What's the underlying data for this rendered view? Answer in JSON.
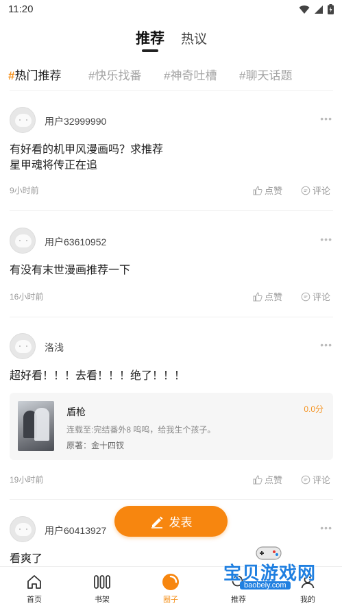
{
  "status_bar": {
    "time": "11:20"
  },
  "top_tabs": [
    {
      "label": "推荐",
      "active": true
    },
    {
      "label": "热议",
      "active": false
    }
  ],
  "topics": [
    {
      "hash": "#",
      "label": "热门推荐",
      "active": true
    },
    {
      "hash": "#",
      "label": "快乐找番",
      "active": false
    },
    {
      "hash": "#",
      "label": "神奇吐槽",
      "active": false
    },
    {
      "hash": "#",
      "label": "聊天话题",
      "active": false
    }
  ],
  "posts": [
    {
      "username": "用户32999990",
      "content": "有好看的机甲风漫画吗？求推荐\n星甲魂将传正在追",
      "time": "9小时前"
    },
    {
      "username": "用户63610952",
      "content": "有没有末世漫画推荐一下",
      "time": "16小时前"
    },
    {
      "username": "洛浅",
      "content": "超好看！！！去看！！！绝了！！！",
      "time": "19小时前"
    },
    {
      "username": "用户60413927",
      "content": "看爽了",
      "time": ""
    }
  ],
  "actions": {
    "like": "点赞",
    "comment": "评论"
  },
  "book": {
    "title": "盾枪",
    "score": "0.0分",
    "status": "连载至:完结番外8 呜呜，给我生个孩子。",
    "author": "原著：金十四钗"
  },
  "fab_label": "发表",
  "bottom_nav": [
    {
      "label": "首页",
      "icon": "home-icon",
      "active": false
    },
    {
      "label": "书架",
      "icon": "bookshelf-icon",
      "active": false
    },
    {
      "label": "圈子",
      "icon": "circle-icon",
      "active": true
    },
    {
      "label": "推荐",
      "icon": "recommend-icon",
      "active": false
    },
    {
      "label": "我的",
      "icon": "profile-icon",
      "active": false
    }
  ],
  "watermark": {
    "text": "宝贝游戏网",
    "url": "baobeiy.com"
  },
  "colors": {
    "accent": "#f5921e",
    "fab": "#f7860f",
    "watermark": "#1f7fe0"
  }
}
